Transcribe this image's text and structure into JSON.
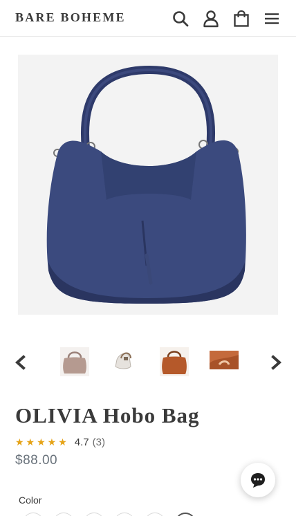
{
  "header": {
    "logo": "BARE BOHEME",
    "icons": [
      "search-icon",
      "account-icon",
      "cart-icon",
      "menu-icon"
    ]
  },
  "product": {
    "title": "OLIVIA Hobo Bag",
    "rating": {
      "stars": "★★★★★",
      "value": "4.7",
      "count": "(3)"
    },
    "price": "$88.00",
    "color_label": "Color",
    "main_image_alt": "Navy blue hobo bag"
  },
  "gallery": {
    "prev_icon": "chevron-left-icon",
    "next_icon": "chevron-right-icon",
    "thumbnails": [
      "taupe-bag-thumbnail",
      "white-bag-thumbnail",
      "cognac-bag-thumbnail",
      "brown-bag-detail-thumbnail"
    ]
  },
  "colors": {
    "bag_main": "#3b4a7e",
    "bag_shadow": "#2a3560",
    "star": "#e5a317",
    "price": "#69727b",
    "text": "#3a3a3a"
  },
  "chat": {
    "icon": "chat-icon"
  }
}
